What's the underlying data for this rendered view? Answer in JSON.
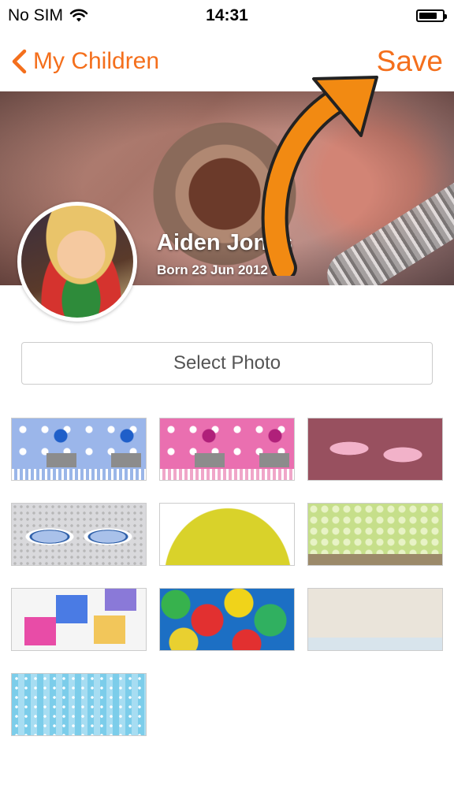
{
  "status_bar": {
    "carrier": "No SIM",
    "time": "14:31",
    "battery_level": 0.8,
    "wifi_icon": "wifi-icon"
  },
  "nav": {
    "back_label": "My Children",
    "save_label": "Save"
  },
  "profile": {
    "name": "Aiden Jones",
    "born": "Born 23 Jun 2012"
  },
  "select_photo_label": "Select Photo",
  "colors": {
    "accent": "#f46f1c",
    "arrow_overlay": "#f28a12"
  },
  "cover_options": [
    "blue-flowers",
    "pink-flowers",
    "pink-baby-shoes",
    "blue-footprints",
    "cartoon-animals",
    "green-nursery",
    "abc-blocks",
    "colored-balls",
    "nursery-room",
    "blue-stripes"
  ]
}
